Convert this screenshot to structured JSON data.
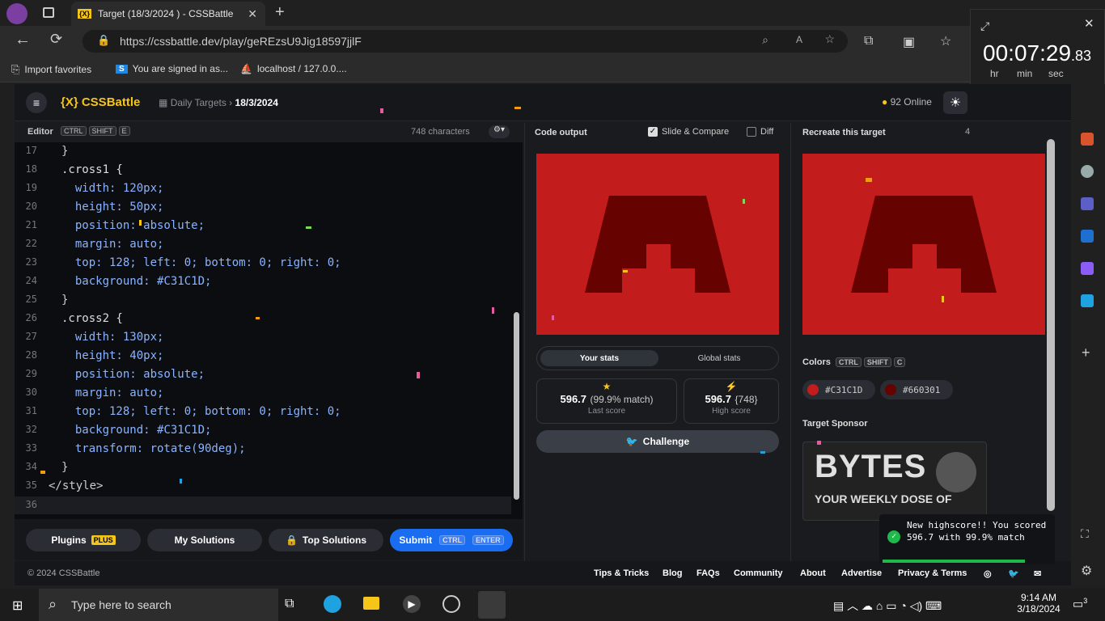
{
  "browser": {
    "tab_title": "Target (18/3/2024 ) - CSSBattle",
    "url": "https://cssbattle.dev/play/geREzsU9Jig18597jjlF",
    "favorites": [
      "Import favorites",
      "You are signed in as...",
      "localhost / 127.0.0...."
    ]
  },
  "timer": {
    "hours": "00",
    "minutes": "07",
    "seconds": "29",
    "hundredths": ".83",
    "hr_label": "hr",
    "min_label": "min",
    "sec_label": "sec"
  },
  "site": {
    "logo": "{X} CSSBattle",
    "breadcrumb_parent": "Daily Targets",
    "breadcrumb_current": "18/3/2024",
    "online": "92 Online"
  },
  "editor": {
    "title": "Editor",
    "keys": [
      "CTRL",
      "SHIFT",
      "E"
    ],
    "char_count": "748 characters",
    "lines": [
      {
        "n": "17",
        "text": "}"
      },
      {
        "n": "18",
        "text": ".cross1 {"
      },
      {
        "n": "19",
        "text": "  width: 120px;"
      },
      {
        "n": "20",
        "text": "  height: 50px;"
      },
      {
        "n": "21",
        "text": "  position: absolute;"
      },
      {
        "n": "22",
        "text": "  margin: auto;"
      },
      {
        "n": "23",
        "text": "  top: 128; left: 0; bottom: 0; right: 0;"
      },
      {
        "n": "24",
        "text": "  background: #C31C1D;"
      },
      {
        "n": "25",
        "text": "}"
      },
      {
        "n": "26",
        "text": ".cross2 {"
      },
      {
        "n": "27",
        "text": "  width: 130px;"
      },
      {
        "n": "28",
        "text": "  height: 40px;"
      },
      {
        "n": "29",
        "text": "  position: absolute;"
      },
      {
        "n": "30",
        "text": "  margin: auto;"
      },
      {
        "n": "31",
        "text": "  top: 128; left: 0; bottom: 0; right: 0;"
      },
      {
        "n": "32",
        "text": "  background: #C31C1D;"
      },
      {
        "n": "33",
        "text": "  transform: rotate(90deg);"
      },
      {
        "n": "34",
        "text": "}"
      },
      {
        "n": "35",
        "text": "</style>"
      },
      {
        "n": "36",
        "text": ""
      }
    ],
    "buttons": {
      "plugins": "Plugins",
      "plugins_badge": "PLUS",
      "solutions": "My Solutions",
      "top": "Top Solutions",
      "submit": "Submit",
      "submit_keys": [
        "CTRL",
        "ENTER"
      ]
    }
  },
  "output": {
    "title": "Code output",
    "slide_compare": "Slide & Compare",
    "diff": "Diff",
    "tab_your": "Your stats",
    "tab_global": "Global stats",
    "last_score": "596.7",
    "last_match": "(99.9% match)",
    "last_label": "Last score",
    "high_score": "596.7",
    "high_chars": "{748}",
    "high_label": "High score",
    "challenge": "Challenge"
  },
  "target": {
    "title": "Recreate this target",
    "index": "4",
    "colors_title": "Colors",
    "color_keys": [
      "CTRL",
      "SHIFT",
      "C"
    ],
    "colors": [
      "#C31C1D",
      "#660301"
    ],
    "sponsor_title": "Target Sponsor",
    "sponsor_top": "BYTES",
    "sponsor_bottom": "YOUR WEEKLY DOSE OF"
  },
  "toast": {
    "message": "New highscore!! You scored 596.7 with 99.9% match"
  },
  "footer": {
    "copyright": "© 2024 CSSBattle",
    "links": [
      "Tips & Tricks",
      "Blog",
      "FAQs",
      "Community",
      "About",
      "Advertise",
      "Privacy & Terms"
    ]
  },
  "taskbar": {
    "search_placeholder": "Type here to search",
    "time": "9:14 AM",
    "date": "3/18/2024",
    "notifications": "3"
  },
  "colors": {
    "accent": "#f5c518",
    "target_red": "#C31C1D",
    "target_dark": "#660301",
    "submit_blue": "#1a6cf0"
  }
}
